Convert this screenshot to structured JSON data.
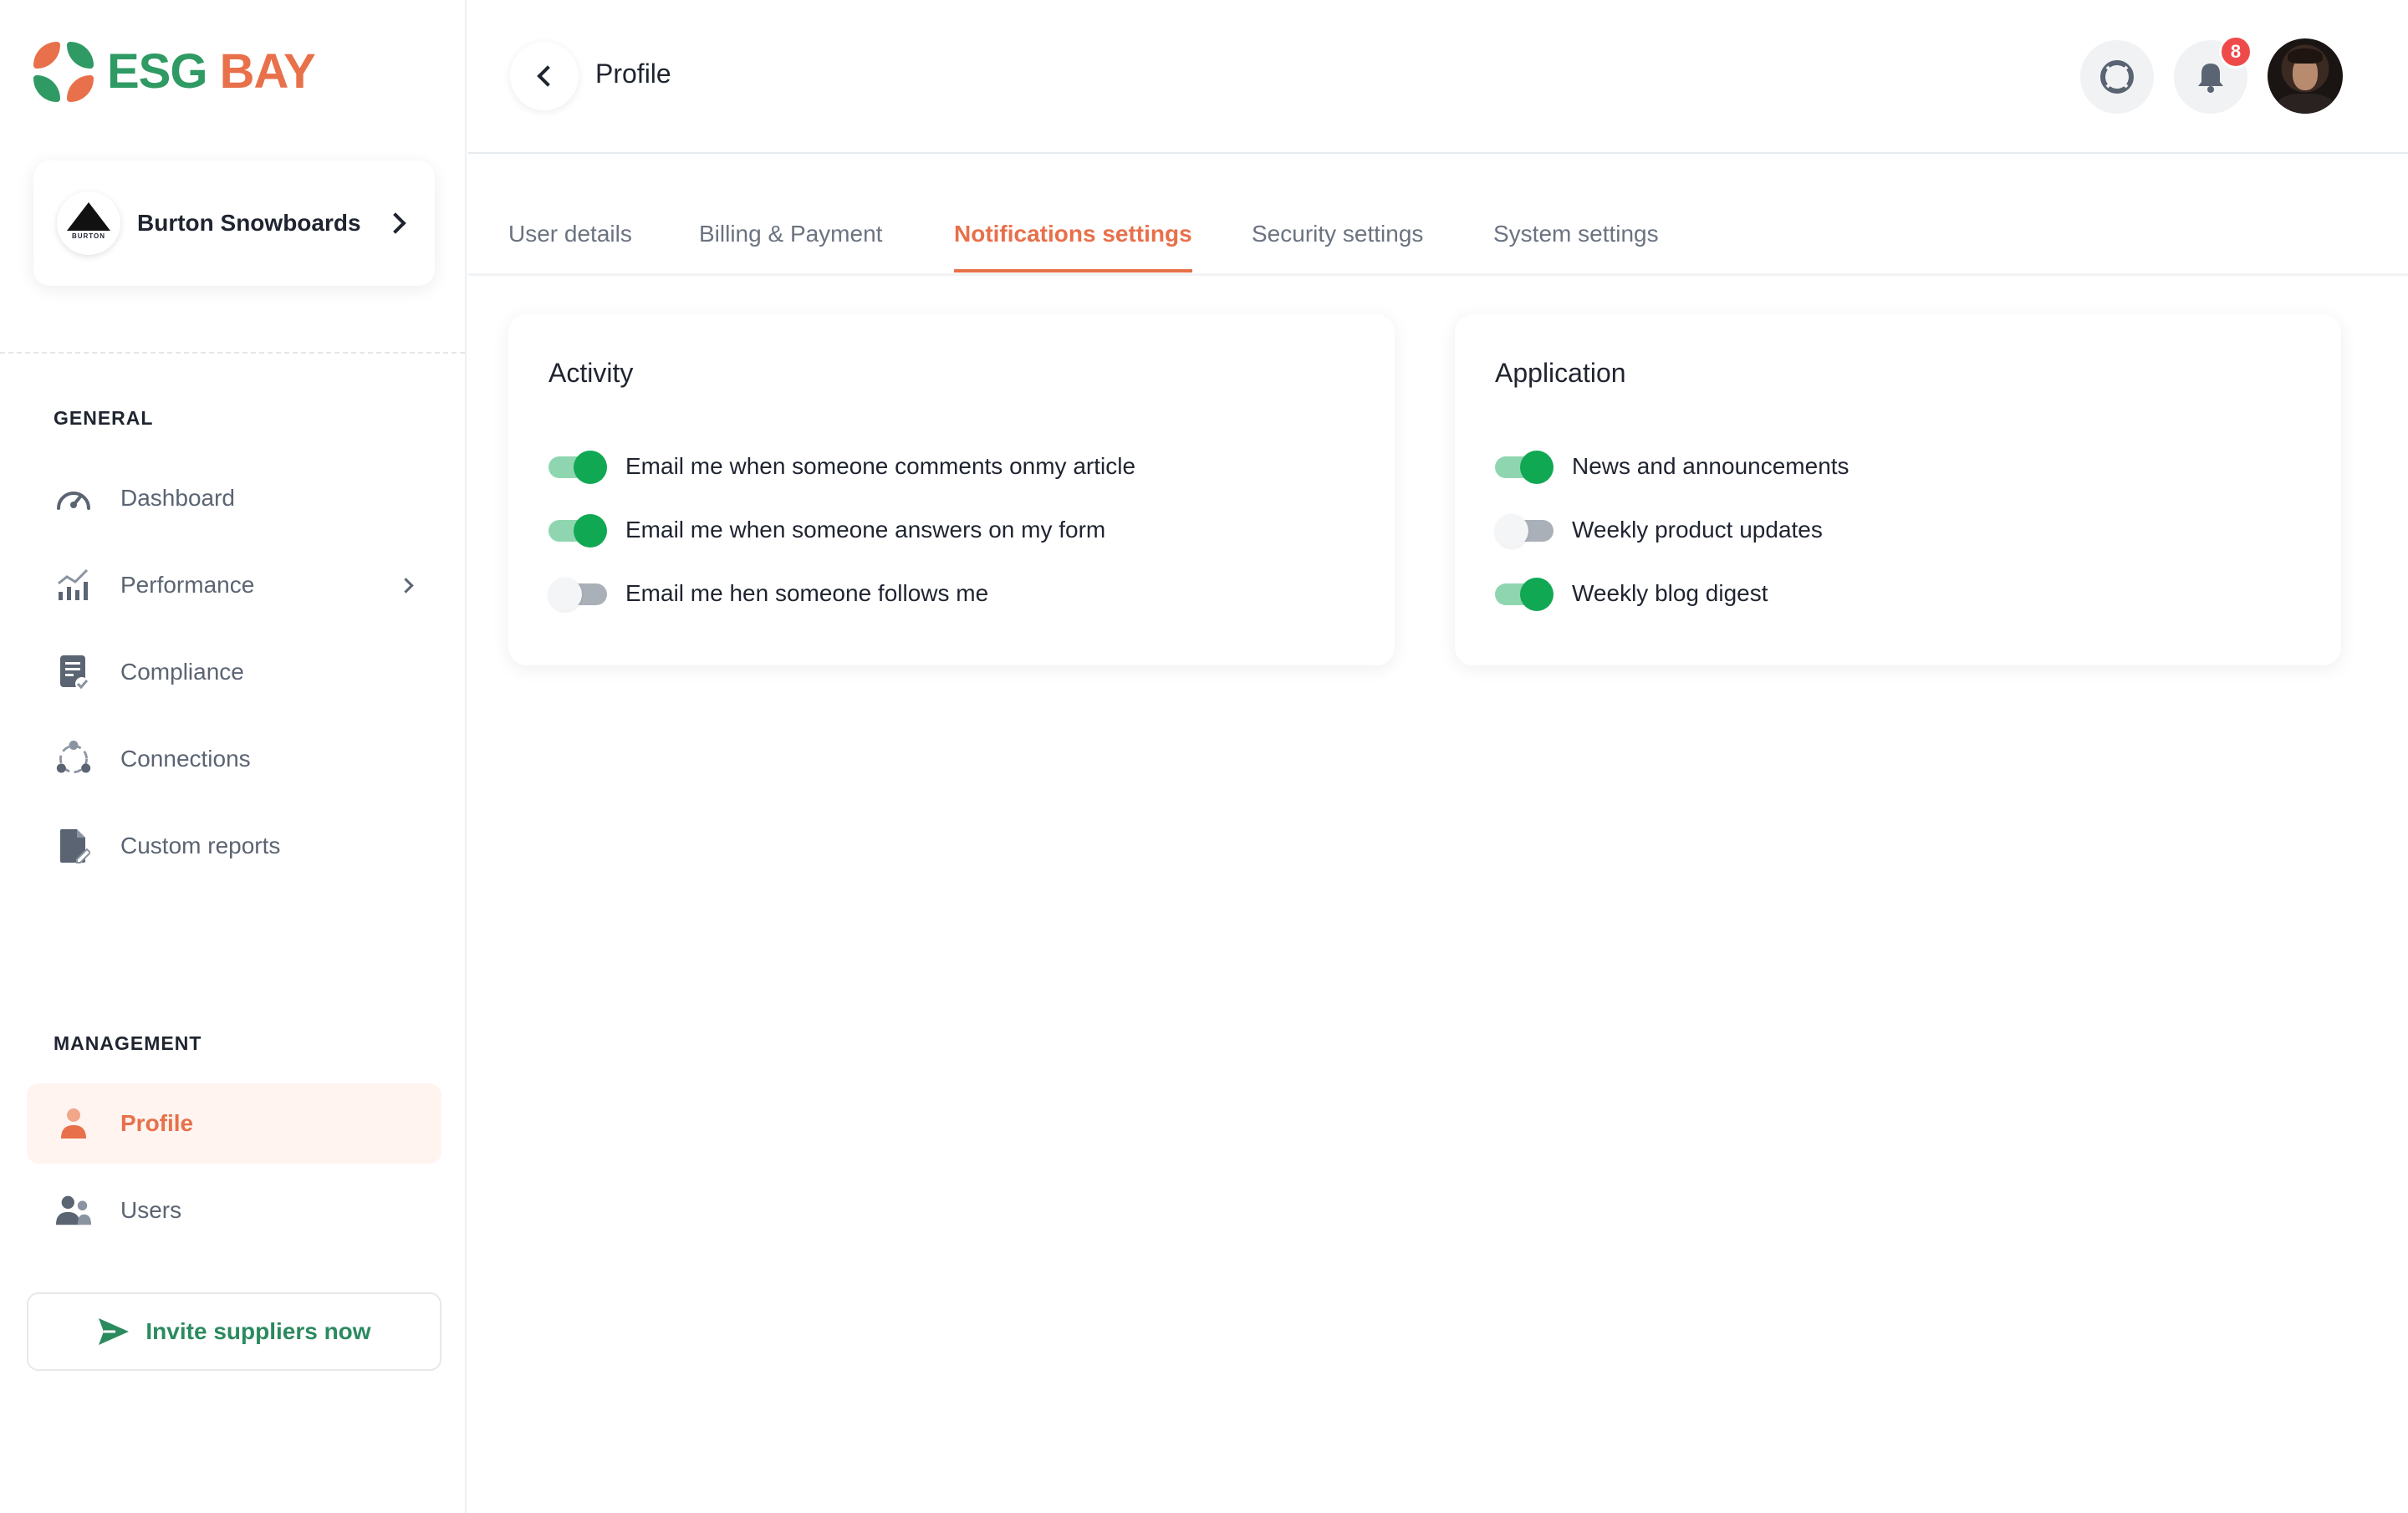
{
  "brand": {
    "part1": "ESG",
    "part2": "BAY"
  },
  "org": {
    "name": "Burton Snowboards",
    "logo_text": "BURTON"
  },
  "sidebar": {
    "general_title": "GENERAL",
    "general_items": [
      {
        "label": "Dashboard",
        "icon": "gauge-icon"
      },
      {
        "label": "Performance",
        "icon": "chart-icon"
      },
      {
        "label": "Compliance",
        "icon": "document-check-icon"
      },
      {
        "label": "Connections",
        "icon": "network-icon"
      },
      {
        "label": "Custom reports",
        "icon": "report-icon"
      }
    ],
    "management_title": "MANAGEMENT",
    "management_items": [
      {
        "label": "Profile",
        "icon": "person-icon",
        "active": true
      },
      {
        "label": "Users",
        "icon": "users-icon"
      }
    ],
    "invite_label": "Invite suppliers now"
  },
  "header": {
    "title": "Profile",
    "notification_count": "8"
  },
  "tabs": [
    {
      "label": "User details"
    },
    {
      "label": "Billing & Payment"
    },
    {
      "label": "Notifications settings",
      "active": true
    },
    {
      "label": "Security settings"
    },
    {
      "label": "System settings"
    }
  ],
  "activity": {
    "title": "Activity",
    "items": [
      {
        "label": "Email me when someone comments onmy article",
        "enabled": true
      },
      {
        "label": "Email me when someone answers on my form",
        "enabled": true
      },
      {
        "label": "Email me hen someone follows me",
        "enabled": false
      }
    ]
  },
  "application": {
    "title": "Application",
    "items": [
      {
        "label": "News and announcements",
        "enabled": true
      },
      {
        "label": "Weekly product updates",
        "enabled": false
      },
      {
        "label": "Weekly blog digest",
        "enabled": true
      }
    ]
  },
  "colors": {
    "accent": "#e8704a",
    "brand_green": "#2f9a63",
    "toggle_on": "#10a853"
  }
}
